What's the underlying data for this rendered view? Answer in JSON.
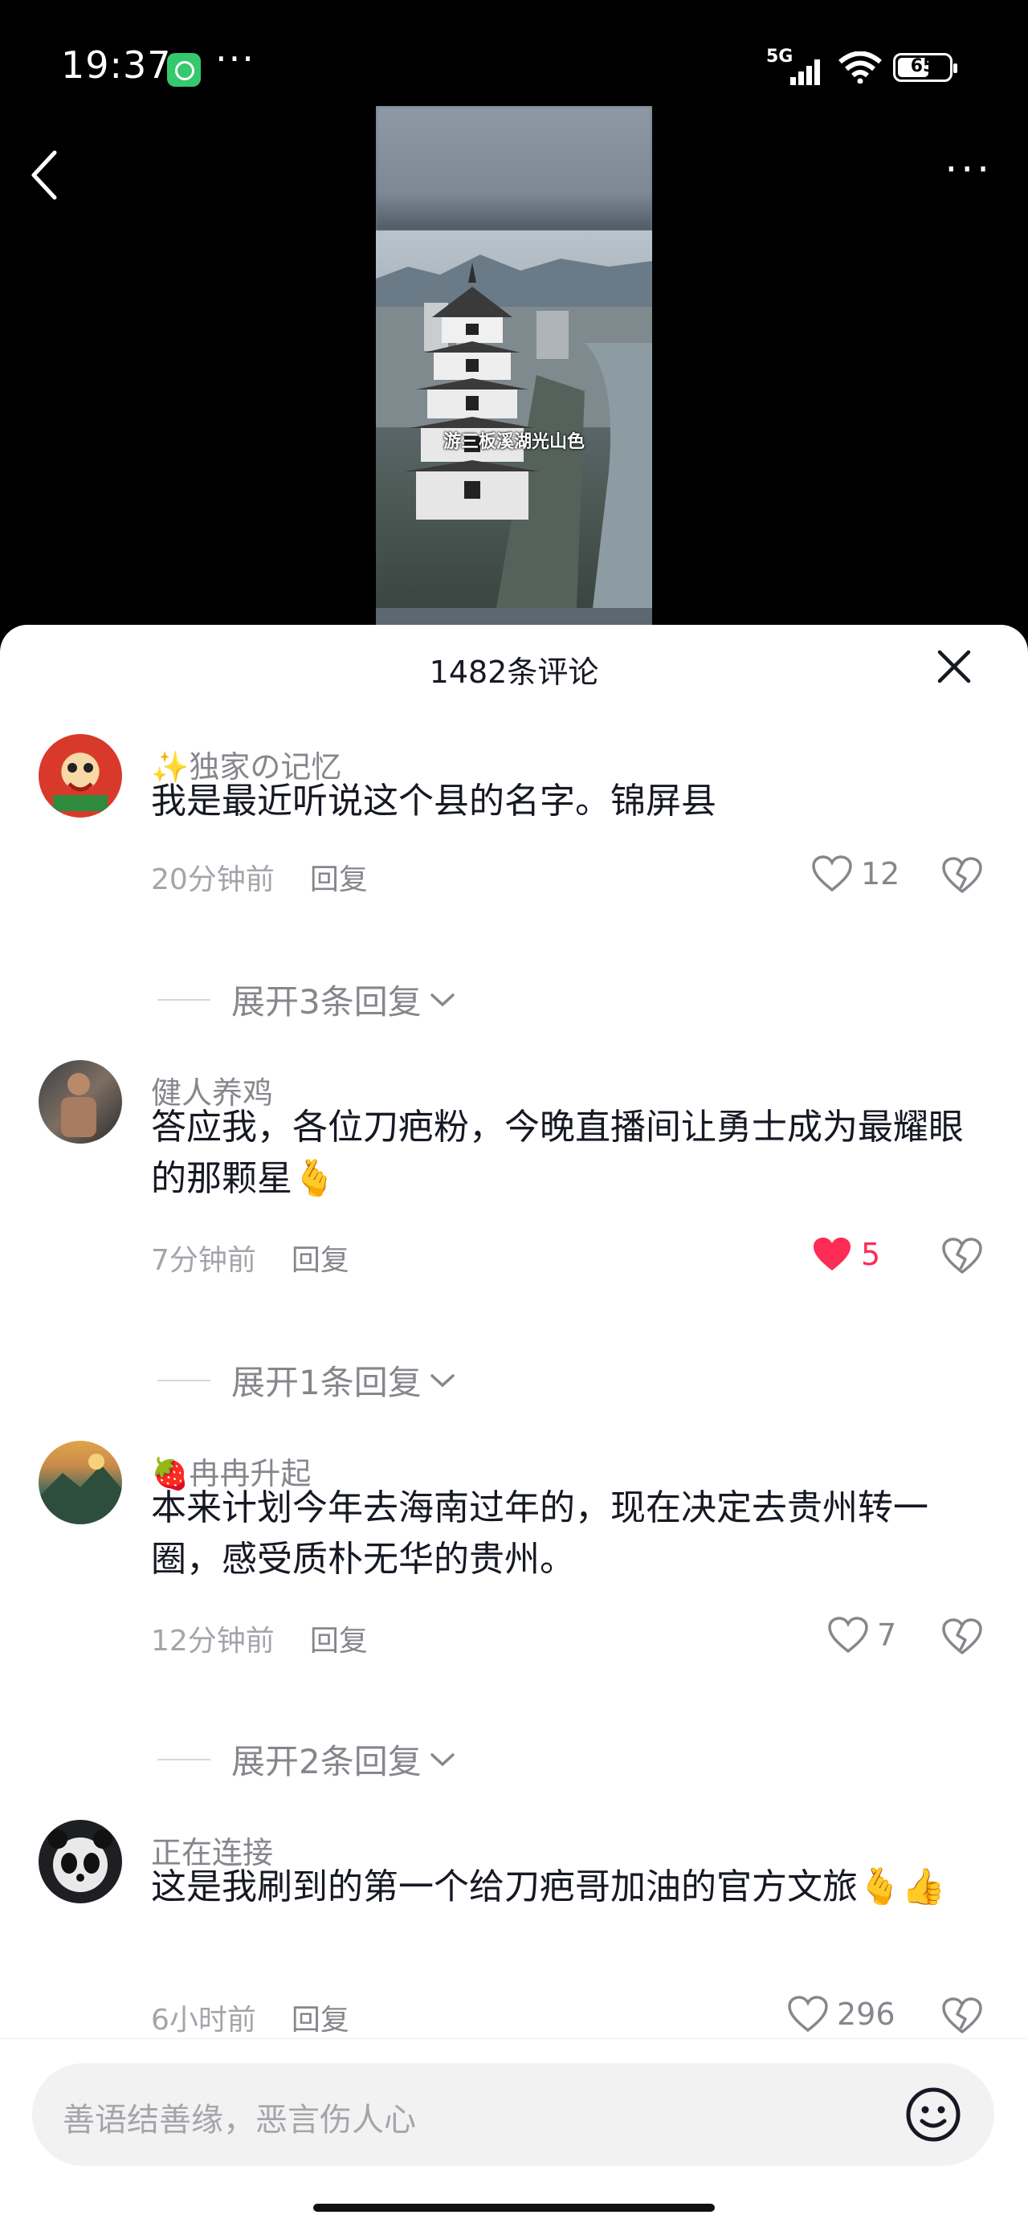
{
  "status_bar": {
    "time": "19:37",
    "dots": "···",
    "network": "5G",
    "battery": "65"
  },
  "video": {
    "caption": "游三板溪湖光山色"
  },
  "comments_sheet": {
    "title": "1482条评论",
    "comments": [
      {
        "username": "✨独家の记忆",
        "text": "我是最近听说这个县的名字。锦屏县",
        "time": "20分钟前",
        "reply": "回复",
        "likes": "12",
        "liked": false,
        "expand": "展开3条回复"
      },
      {
        "username": "健人养鸡",
        "text": "答应我，各位刀疤粉，今晚直播间让勇士成为最耀眼的那颗星🫰",
        "time": "7分钟前",
        "reply": "回复",
        "likes": "5",
        "liked": true,
        "expand": "展开1条回复"
      },
      {
        "username": "🍓冉冉升起",
        "text": "本来计划今年去海南过年的，现在决定去贵州转一圈，感受质朴无华的贵州。",
        "time": "12分钟前",
        "reply": "回复",
        "likes": "7",
        "liked": false,
        "expand": "展开2条回复"
      },
      {
        "username": "正在连接",
        "text": "这是我刷到的第一个给刀疤哥加油的官方文旅🫰👍",
        "time": "6小时前",
        "reply": "回复",
        "likes": "296",
        "liked": false,
        "expand": ""
      }
    ]
  },
  "input": {
    "placeholder": "善语结善缘，恶言伤人心"
  },
  "colors": {
    "like_active": "#fe2c55",
    "secondary_text": "#86878c",
    "primary_text": "#161823"
  }
}
